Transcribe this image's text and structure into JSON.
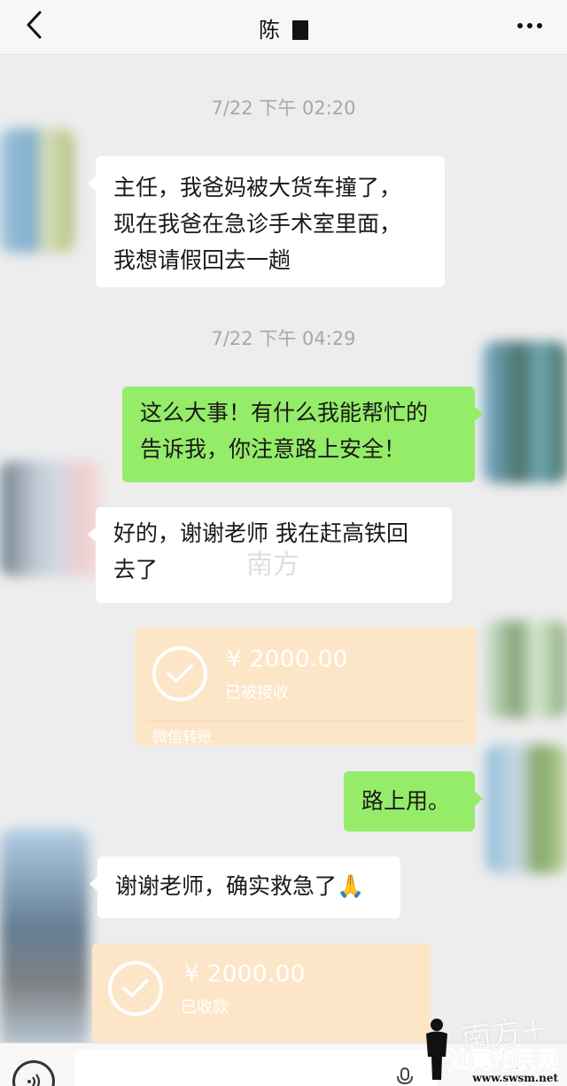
{
  "header": {
    "title": "陈"
  },
  "timestamps": [
    "7/22 下午 02:20",
    "7/22 下午 04:29"
  ],
  "messages": [
    {
      "side": "in",
      "lines": [
        "主任，我爸妈被大货车撞了，",
        "现在我爸在急诊手术室里面，",
        "我想请假回去一趟"
      ]
    },
    {
      "side": "out",
      "lines": [
        "这么大事！有什么我能帮忙的",
        "告诉我，你注意路上安全！"
      ]
    },
    {
      "side": "in",
      "lines": [
        "好的，谢谢老师 我在赶高铁回",
        "去了"
      ]
    },
    {
      "side": "out",
      "lines": [
        "路上用。"
      ]
    },
    {
      "side": "in",
      "lines": [
        "谢谢老师，确实救急了🙏"
      ]
    }
  ],
  "transfers": [
    {
      "amount": "¥ 2000.00",
      "status": "已被接收",
      "footer": "微信转账"
    },
    {
      "amount": "¥ 2000.00",
      "status": "已收款"
    }
  ],
  "watermarks": {
    "center": "南方",
    "brand": "南方+",
    "site_name": "汕尾市民网",
    "site_url": "www.swsm.net"
  },
  "colors": {
    "background": "#ededed",
    "incoming_bubble": "#ffffff",
    "outgoing_bubble": "#95ec69",
    "transfer_card": "#fde6c8",
    "timestamp_text": "#a8a8a8"
  },
  "icons": [
    "back-chevron-icon",
    "more-dots-icon",
    "check-circle-icon",
    "voice-icon",
    "mic-icon"
  ]
}
